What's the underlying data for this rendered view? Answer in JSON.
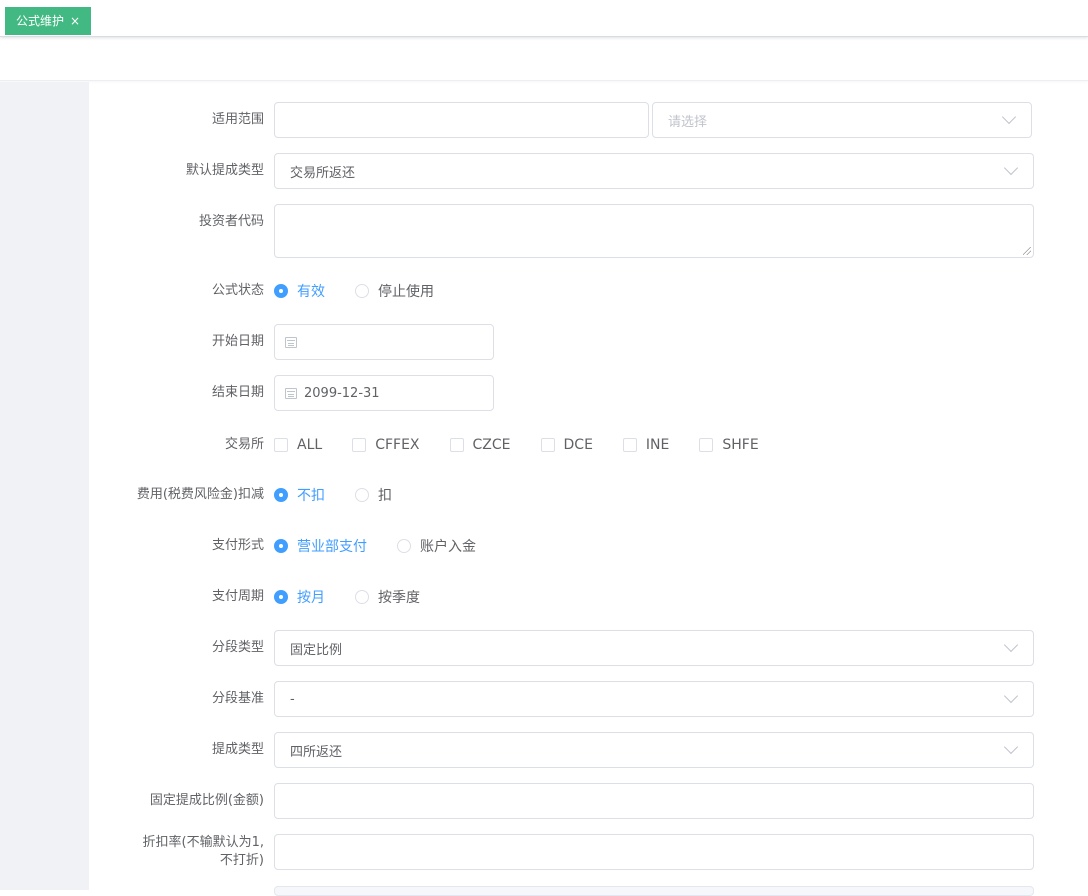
{
  "tabbar": {
    "active_tab": "公式维护",
    "close_glyph": "×"
  },
  "form": {
    "scope": {
      "label": "适用范围",
      "value": "",
      "select_placeholder": "请选择"
    },
    "default_commission_type": {
      "label": "默认提成类型",
      "value": "交易所返还"
    },
    "investor_code": {
      "label": "投资者代码",
      "value": ""
    },
    "formula_status": {
      "label": "公式状态",
      "options": [
        "有效",
        "停止使用"
      ],
      "selected": "有效"
    },
    "start_date": {
      "label": "开始日期",
      "value": ""
    },
    "end_date": {
      "label": "结束日期",
      "value": "2099-12-31"
    },
    "exchange": {
      "label": "交易所",
      "options": [
        "ALL",
        "CFFEX",
        "CZCE",
        "DCE",
        "INE",
        "SHFE"
      ],
      "checked": []
    },
    "fee_deduction": {
      "label": "费用(税费风险金)扣减",
      "options": [
        "不扣",
        "扣"
      ],
      "selected": "不扣"
    },
    "payment_form": {
      "label": "支付形式",
      "options": [
        "营业部支付",
        "账户入金"
      ],
      "selected": "营业部支付"
    },
    "payment_cycle": {
      "label": "支付周期",
      "options": [
        "按月",
        "按季度"
      ],
      "selected": "按月"
    },
    "segment_type": {
      "label": "分段类型",
      "value": "固定比例"
    },
    "segment_basis": {
      "label": "分段基准",
      "value": "-"
    },
    "commission_type": {
      "label": "提成类型",
      "value": "四所返还"
    },
    "fixed_ratio": {
      "label": "固定提成比例(金额)",
      "value": ""
    },
    "discount_rate": {
      "label_line1": "折扣率(不输默认为1,",
      "label_line2": "不打折)",
      "value": ""
    }
  },
  "colors": {
    "accent": "#409eff",
    "tab_green": "#42b983",
    "sidebar": "#f0f2f5"
  }
}
